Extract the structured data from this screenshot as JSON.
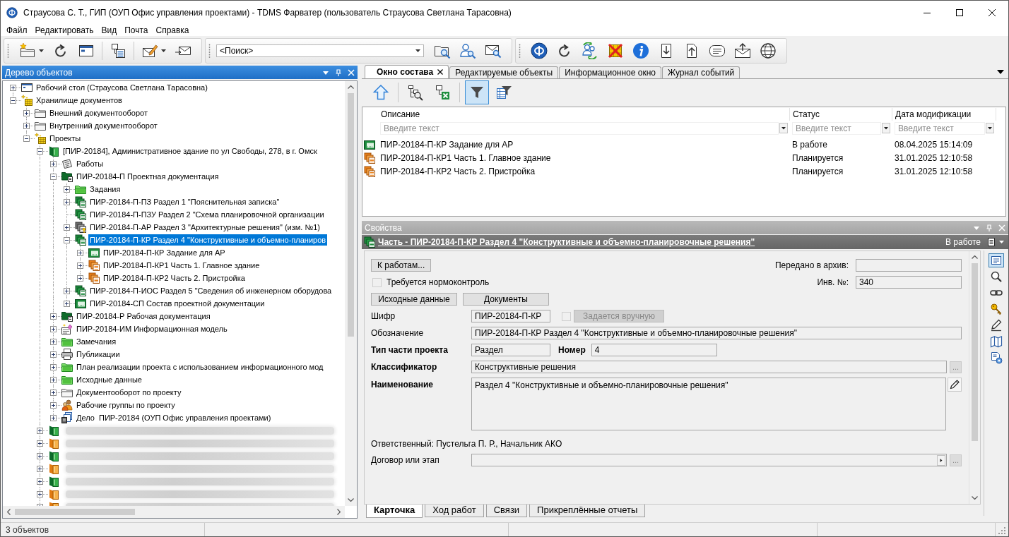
{
  "window": {
    "title": "Страусова С. Т., ГИП (ОУП Офис управления проектами) - TDMS Фарватер (пользователь Страусова Светлана Тарасовна)"
  },
  "menu": [
    {
      "label": "Файл"
    },
    {
      "label": "Редактировать"
    },
    {
      "label": "Вид"
    },
    {
      "label": "Почта"
    },
    {
      "label": "Справка"
    }
  ],
  "toolbars": [
    {
      "items": [
        {
          "kind": "new",
          "dropdown": true
        },
        {
          "kind": "refresh"
        },
        {
          "kind": "window"
        },
        {
          "kind": "separator"
        },
        {
          "kind": "structure"
        },
        {
          "kind": "separator"
        },
        {
          "kind": "compose",
          "dropdown": true
        },
        {
          "kind": "send"
        }
      ]
    },
    {
      "items": [
        {
          "kind": "search",
          "placeholder": "<Поиск>"
        },
        {
          "kind": "folder-search"
        },
        {
          "kind": "user-search"
        },
        {
          "kind": "mail-search"
        }
      ]
    },
    {
      "items": [
        {
          "kind": "logo"
        },
        {
          "kind": "refresh"
        },
        {
          "kind": "users-sync"
        },
        {
          "kind": "grid-cross"
        },
        {
          "kind": "info"
        },
        {
          "kind": "doc-down"
        },
        {
          "kind": "doc-up"
        },
        {
          "kind": "message"
        },
        {
          "kind": "mail-up"
        },
        {
          "kind": "globe"
        }
      ]
    }
  ],
  "tree": {
    "title": "Дерево объектов",
    "items": [
      {
        "label": "Рабочий стол (Страусова Светлана Тарасовна)",
        "kind": "desktop",
        "expanded": false,
        "selected": false
      },
      {
        "label": "Хранилище документов",
        "kind": "storage",
        "expanded": true,
        "selected": false,
        "children": [
          {
            "label": "Внешний документооборот",
            "kind": "folder",
            "expanded": false,
            "selected": false
          },
          {
            "label": "Внутренний документооборот",
            "kind": "folder",
            "expanded": false,
            "selected": false
          },
          {
            "label": "Проекты",
            "kind": "storage",
            "expanded": true,
            "selected": false,
            "children": [
              {
                "label": "[ПИР-20184], Административное здание по ул Свободы, 278, в г. Омск",
                "kind": "project",
                "expanded": true,
                "selected": false,
                "children": [
                  {
                    "label": "Работы",
                    "kind": "works",
                    "expanded": false,
                    "selected": false
                  },
                  {
                    "label": "ПИР-20184-П Проектная документация",
                    "kind": "docset",
                    "expanded": true,
                    "selected": false,
                    "children": [
                      {
                        "label": "Задания",
                        "kind": "folder-green",
                        "expanded": false,
                        "selected": false
                      },
                      {
                        "label": "ПИР-20184-П-ПЗ Раздел 1 \"Пояснительная записка\"",
                        "kind": "section",
                        "expanded": false,
                        "selected": false
                      },
                      {
                        "label": "ПИР-20184-П-ПЗУ Раздел 2 \"Схема планировочной организации",
                        "kind": "section",
                        "leaf": true,
                        "selected": false
                      },
                      {
                        "label": "ПИР-20184-П-АР Раздел 3 \"Архитектурные решения\" (изм. №1)",
                        "kind": "section-key",
                        "expanded": false,
                        "selected": false
                      },
                      {
                        "label": "ПИР-20184-П-КР Раздел 4 \"Конструктивные и объемно-планиров",
                        "kind": "section",
                        "expanded": true,
                        "selected": true,
                        "children": [
                          {
                            "label": "ПИР-20184-П-КР Задание для АР",
                            "kind": "sheet",
                            "expanded": false,
                            "selected": false
                          },
                          {
                            "label": "ПИР-20184-П-КР1 Часть 1. Главное здание",
                            "kind": "part",
                            "expanded": false,
                            "selected": false
                          },
                          {
                            "label": "ПИР-20184-П-КР2 Часть 2. Пристройка",
                            "kind": "part",
                            "expanded": false,
                            "selected": false
                          }
                        ]
                      },
                      {
                        "label": "ПИР-20184-П-ИОС Раздел 5 \"Сведения об инженерном оборудова",
                        "kind": "section",
                        "expanded": false,
                        "selected": false
                      },
                      {
                        "label": "ПИР-20184-СП Состав проектной документации",
                        "kind": "sheet",
                        "expanded": false,
                        "selected": false
                      }
                    ]
                  },
                  {
                    "label": "ПИР-20184-Р Рабочая документация",
                    "kind": "docset",
                    "expanded": false,
                    "selected": false
                  },
                  {
                    "label": "ПИР-20184-ИМ Информационная модель",
                    "kind": "model",
                    "expanded": false,
                    "selected": false
                  },
                  {
                    "label": "Замечания",
                    "kind": "folder-green",
                    "expanded": false,
                    "selected": false
                  },
                  {
                    "label": "Публикации",
                    "kind": "publications",
                    "expanded": false,
                    "selected": false
                  },
                  {
                    "label": "План реализации проекта с использованием информационного мод",
                    "kind": "folder-green",
                    "expanded": false,
                    "selected": false
                  },
                  {
                    "label": "Исходные данные",
                    "kind": "folder-green",
                    "expanded": false,
                    "selected": false
                  },
                  {
                    "label": "Документооборот по проекту",
                    "kind": "folder",
                    "expanded": false,
                    "selected": false
                  },
                  {
                    "label": "Рабочие группы по проекту",
                    "kind": "people",
                    "expanded": false,
                    "selected": false
                  },
                  {
                    "label": "Дело  ПИР-20184 (ОУП Офис управления проектами)",
                    "kind": "case",
                    "expanded": false,
                    "selected": false
                  }
                ]
              },
              {
                "kind": "project",
                "redacted": true,
                "expanded": false,
                "selected": false
              },
              {
                "kind": "project-orange",
                "redacted": true,
                "expanded": false,
                "selected": false
              },
              {
                "kind": "project",
                "redacted": true,
                "expanded": false,
                "selected": false
              },
              {
                "kind": "project-orange",
                "redacted": true,
                "expanded": false,
                "selected": false
              },
              {
                "kind": "project",
                "redacted": true,
                "expanded": false,
                "selected": false
              },
              {
                "kind": "project-orange",
                "redacted": true,
                "expanded": false,
                "selected": false
              },
              {
                "kind": "project-orange",
                "redacted": true,
                "expanded": false,
                "selected": false
              }
            ]
          }
        ]
      }
    ]
  },
  "composition": {
    "tabs": [
      {
        "label": "Окно состава",
        "selected": true
      },
      {
        "label": "Редактируемые объекты",
        "selected": false
      },
      {
        "label": "Информационное окно",
        "selected": false
      },
      {
        "label": "Журнал событий",
        "selected": false
      }
    ],
    "toolbar": [
      {
        "kind": "up"
      },
      {
        "kind": "separator"
      },
      {
        "kind": "tree-search"
      },
      {
        "kind": "excel"
      },
      {
        "kind": "separator"
      },
      {
        "kind": "filter",
        "on": true
      },
      {
        "kind": "filter-table",
        "on": false
      }
    ],
    "table": {
      "columns": [
        {
          "label": "Описание",
          "placeholder": "Введите текст"
        },
        {
          "label": "Статус",
          "placeholder": "Введите текст"
        },
        {
          "label": "Дата модификации",
          "placeholder": "Введите текст"
        }
      ],
      "rows": [
        {
          "kind": "sheet",
          "description": "ПИР-20184-П-КР Задание для АР",
          "status": "В работе",
          "modified": "08.04.2025 15:14:09"
        },
        {
          "kind": "part",
          "description": "ПИР-20184-П-КР1 Часть 1. Главное здание",
          "status": "Планируется",
          "modified": "31.01.2025 12:10:58"
        },
        {
          "kind": "part",
          "description": "ПИР-20184-П-КР2 Часть 2. Пристройка",
          "status": "Планируется",
          "modified": "31.01.2025 12:10:58"
        }
      ]
    }
  },
  "properties": {
    "title": "Свойства",
    "object": {
      "kind": "section",
      "title": "Часть - ПИР-20184-П-КР Раздел 4 \"Конструктивные и объемно-планировочные решения\"",
      "status": "В работе"
    },
    "card": {
      "to_works_button": "К работам...",
      "normcontrol": {
        "label": "Требуется нормоконтроль",
        "checked": false,
        "disabled": true
      },
      "archive": {
        "label": "Передано в архив:"
      },
      "inventory": {
        "label": "Инв. №:",
        "value": "340"
      },
      "buttons": [
        {
          "label": "Исходные данные"
        },
        {
          "label": "Документы"
        }
      ],
      "cipher": {
        "label": "Шифр",
        "value": "ПИР-20184-П-КР",
        "required": false
      },
      "manual": {
        "label": "Задается вручную",
        "checked": false,
        "disabled": true
      },
      "designation": {
        "label": "Обозначение",
        "value": "ПИР-20184-П-КР Раздел 4 \"Конструктивные и объемно-планировочные решения\"",
        "required": false
      },
      "part_type": {
        "label": "Тип части проекта",
        "value": "Раздел",
        "required": true
      },
      "number": {
        "label": "Номер",
        "value": "4",
        "required": true
      },
      "classifier": {
        "label": "Классификатор",
        "value": "Конструктивные решения",
        "required": true,
        "browse": "..."
      },
      "name": {
        "label": "Наименование",
        "value": "Раздел 4 \"Конструктивные и объемно-планировочные решения\"",
        "required": true
      },
      "responsible": "Ответственный: Пустельга П. Р., Начальник АКО",
      "contract": {
        "label": "Договор или этап",
        "required": false,
        "browse": "..."
      }
    },
    "side_tools": [
      {
        "kind": "card",
        "selected": true
      },
      {
        "kind": "search",
        "selected": false
      },
      {
        "kind": "link",
        "selected": false
      },
      {
        "kind": "keys",
        "selected": false
      },
      {
        "kind": "pen",
        "selected": false
      },
      {
        "kind": "book",
        "selected": false
      },
      {
        "kind": "doc-gear",
        "selected": false
      }
    ],
    "tabs": [
      {
        "label": "Карточка",
        "selected": true
      },
      {
        "label": "Ход работ",
        "selected": false
      },
      {
        "label": "Связи",
        "selected": false
      },
      {
        "label": "Прикреплённые отчеты",
        "selected": false
      }
    ]
  },
  "status_bar": {
    "text": "3 объектов"
  }
}
